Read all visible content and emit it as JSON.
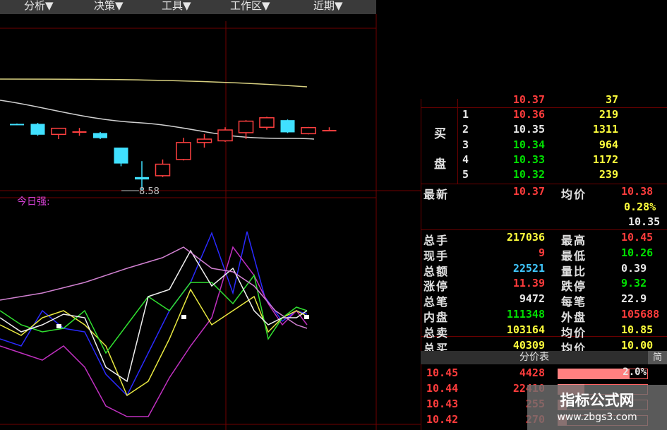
{
  "menu": [
    {
      "label": "分析▼"
    },
    {
      "label": "决策▼"
    },
    {
      "label": "工具▼"
    },
    {
      "label": "工作区▼"
    },
    {
      "label": "近期▼"
    }
  ],
  "chart": {
    "low_label": "8.58",
    "indicator_title": "今日强:",
    "candles": [
      {
        "o": 10.55,
        "c": 10.55,
        "h": 10.56,
        "l": 10.54,
        "dir": "down"
      },
      {
        "o": 10.55,
        "c": 10.23,
        "h": 10.58,
        "l": 10.2,
        "dir": "down"
      },
      {
        "o": 10.24,
        "c": 10.42,
        "h": 10.43,
        "l": 10.1,
        "dir": "up"
      },
      {
        "o": 10.33,
        "c": 10.33,
        "h": 10.43,
        "l": 10.2,
        "dir": "flat"
      },
      {
        "o": 10.28,
        "c": 10.13,
        "h": 10.31,
        "l": 10.1,
        "dir": "down"
      },
      {
        "o": 9.85,
        "c": 9.38,
        "h": 9.85,
        "l": 9.3,
        "dir": "down"
      },
      {
        "o": 8.98,
        "c": 8.91,
        "h": 9.45,
        "l": 8.58,
        "dir": "down"
      },
      {
        "o": 9.02,
        "c": 9.36,
        "h": 9.5,
        "l": 8.98,
        "dir": "up"
      },
      {
        "o": 9.5,
        "c": 10.0,
        "h": 10.14,
        "l": 9.47,
        "dir": "up"
      },
      {
        "o": 10.0,
        "c": 10.1,
        "h": 10.25,
        "l": 9.85,
        "dir": "up"
      },
      {
        "o": 10.05,
        "c": 10.37,
        "h": 10.45,
        "l": 10.02,
        "dir": "up"
      },
      {
        "o": 10.29,
        "c": 10.63,
        "h": 10.66,
        "l": 10.1,
        "dir": "up"
      },
      {
        "o": 10.45,
        "c": 10.73,
        "h": 10.76,
        "l": 10.38,
        "dir": "up"
      },
      {
        "o": 10.66,
        "c": 10.3,
        "h": 10.68,
        "l": 10.28,
        "dir": "down"
      },
      {
        "o": 10.26,
        "c": 10.44,
        "h": 10.46,
        "l": 10.24,
        "dir": "up"
      },
      {
        "o": 10.37,
        "c": 10.37,
        "h": 10.45,
        "l": 10.34,
        "dir": "flat"
      }
    ]
  },
  "quote": {
    "buy_label_1": "买",
    "buy_label_2": "盘",
    "top_partial": {
      "price": "10.37",
      "vol": "37"
    },
    "bids": [
      {
        "level": "1",
        "price": "10.36",
        "vol": "219",
        "price_color": "red"
      },
      {
        "level": "2",
        "price": "10.35",
        "vol": "1311",
        "price_color": "white"
      },
      {
        "level": "3",
        "price": "10.34",
        "vol": "964",
        "price_color": "green"
      },
      {
        "level": "4",
        "price": "10.33",
        "vol": "1172",
        "price_color": "green"
      },
      {
        "level": "5",
        "price": "10.32",
        "vol": "239",
        "price_color": "green"
      }
    ],
    "latest_label": "最新",
    "latest": "10.37",
    "avg_label": "均价",
    "avg": "10.38",
    "change_pct": "0.28%",
    "prev": "10.35",
    "rows": [
      {
        "l1": "总手",
        "v1": "217036",
        "c1": "yellow",
        "l2": "最高",
        "v2": "10.45",
        "c2": "red"
      },
      {
        "l1": "现手",
        "v1": "9",
        "c1": "red",
        "l2": "最低",
        "v2": "10.26",
        "c2": "green"
      },
      {
        "l1": "总额",
        "v1": "22521",
        "c1": "cyan",
        "l2": "量比",
        "v2": "0.39",
        "c2": "white"
      },
      {
        "l1": "涨停",
        "v1": "11.39",
        "c1": "red",
        "l2": "跌停",
        "v2": "9.32",
        "c2": "green"
      },
      {
        "l1": "总笔",
        "v1": "9472",
        "c1": "white",
        "l2": "每笔",
        "v2": "22.9",
        "c2": "white"
      },
      {
        "l1": "内盘",
        "v1": "111348",
        "c1": "green",
        "l2": "外盘",
        "v2": "105688",
        "c2": "red"
      },
      {
        "l1": "总卖",
        "v1": "103164",
        "c1": "yellow",
        "l2": "均价",
        "v2": "10.85",
        "c2": "yellow"
      },
      {
        "l1": "总买",
        "v1": "40309",
        "c1": "yellow",
        "l2": "均价",
        "v2": "10.00",
        "c2": "yellow"
      }
    ],
    "price_table_title": "分价表",
    "jian": "简",
    "price_table": [
      {
        "price": "10.45",
        "vol": "4428",
        "pct": "2.0%",
        "bar": 0.8
      },
      {
        "price": "10.44",
        "vol": "22410",
        "pct": "",
        "bar": 0.3
      },
      {
        "price": "10.43",
        "vol": "255",
        "pct": "",
        "bar": 0.1
      },
      {
        "price": "10.42",
        "vol": "270",
        "pct": "",
        "bar": 0.1
      }
    ]
  },
  "watermark": {
    "title": "指标公式网",
    "url": "www.zbgs3.com"
  }
}
